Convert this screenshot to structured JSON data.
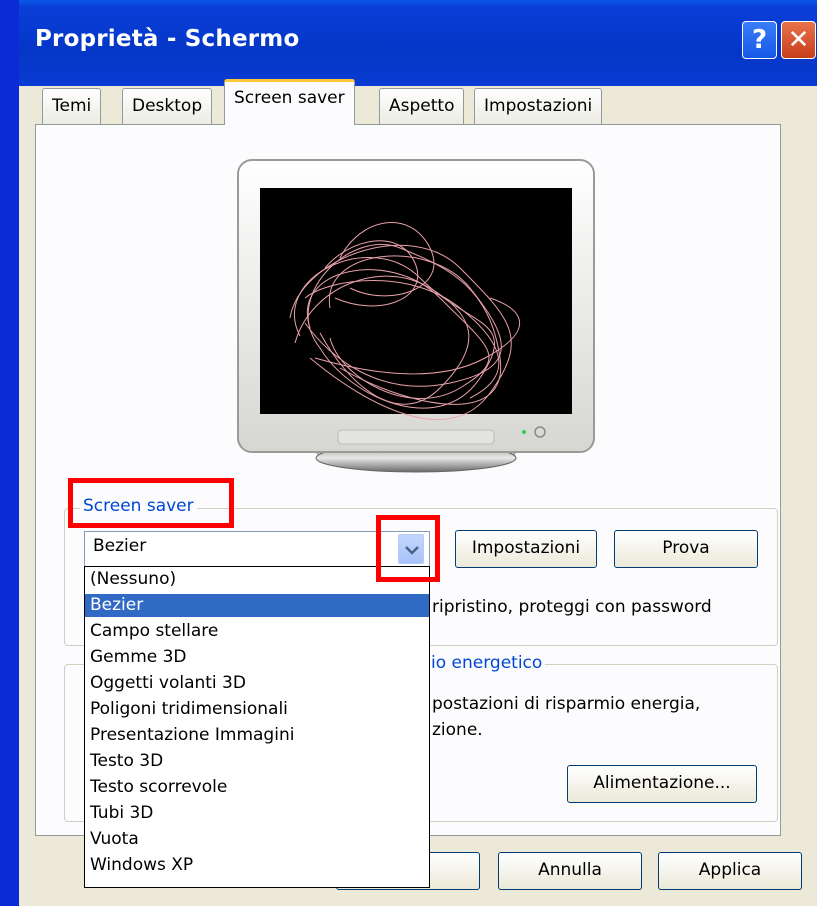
{
  "window": {
    "title": "Proprietà - Schermo",
    "help_glyph": "?",
    "close_glyph": "✕"
  },
  "tabs": [
    "Temi",
    "Desktop",
    "Screen saver",
    "Aspetto",
    "Impostazioni"
  ],
  "screensaver_group": {
    "label": "Screen saver",
    "selected": "Bezier",
    "settings_button": "Impostazioni",
    "preview_button": "Prova",
    "resume_text": "ripristino, proteggi con password"
  },
  "power_group": {
    "label": "io energetico",
    "text_line1": "postazioni di risparmio energia,",
    "text_line2": "zione.",
    "power_button": "Alimentazione..."
  },
  "dropdown_options": [
    "(Nessuno)",
    "Bezier",
    "Campo stellare",
    "Gemme 3D",
    "Oggetti volanti 3D",
    "Poligoni tridimensionali",
    "Presentazione Immagini",
    "Testo 3D",
    "Testo scorrevole",
    "Tubi 3D",
    "Vuota",
    "Windows XP"
  ],
  "dropdown_selected_index": 1,
  "footer": {
    "ok_button": "",
    "cancel_button": "Annulla",
    "apply_button": "Applica"
  },
  "colors": {
    "highlight": "#316ac5",
    "group_label": "#0046d5",
    "annotation_red": "#ff0000",
    "curve": "#e8a0a8"
  }
}
